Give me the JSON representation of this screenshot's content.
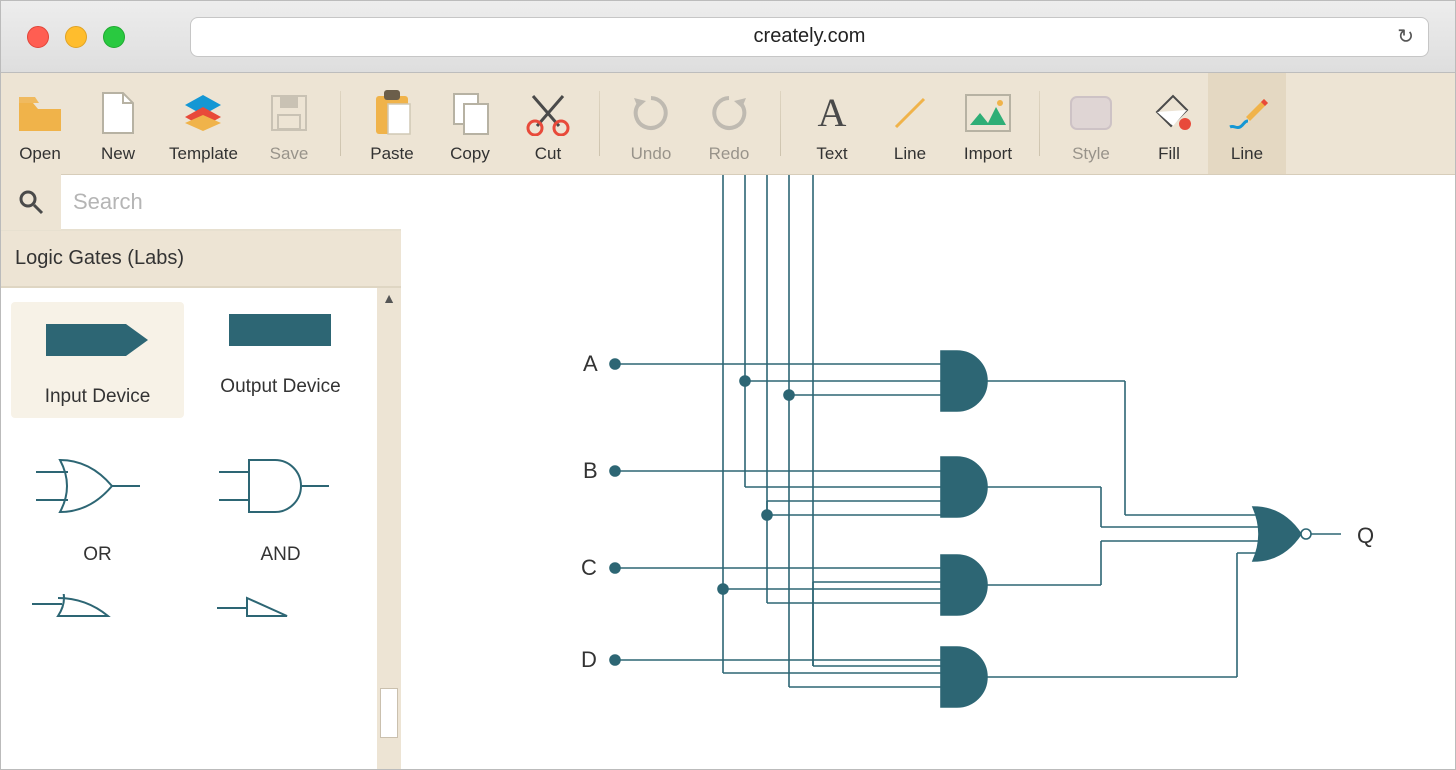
{
  "browser": {
    "url": "creately.com"
  },
  "toolbar": {
    "open": "Open",
    "new": "New",
    "template": "Template",
    "save": "Save",
    "paste": "Paste",
    "copy": "Copy",
    "cut": "Cut",
    "undo": "Undo",
    "redo": "Redo",
    "text": "Text",
    "line": "Line",
    "import": "Import",
    "style": "Style",
    "fill": "Fill",
    "linetool": "Line"
  },
  "sidebar": {
    "search_placeholder": "Search",
    "header": "Logic Gates (Labs)",
    "shapes": {
      "input_device": "Input Device",
      "output_device": "Output Device",
      "or": "OR",
      "and": "AND"
    }
  },
  "circuit": {
    "inputs": [
      "A",
      "B",
      "C",
      "D"
    ],
    "output": "Q"
  },
  "colors": {
    "teal": "#2d6674"
  }
}
